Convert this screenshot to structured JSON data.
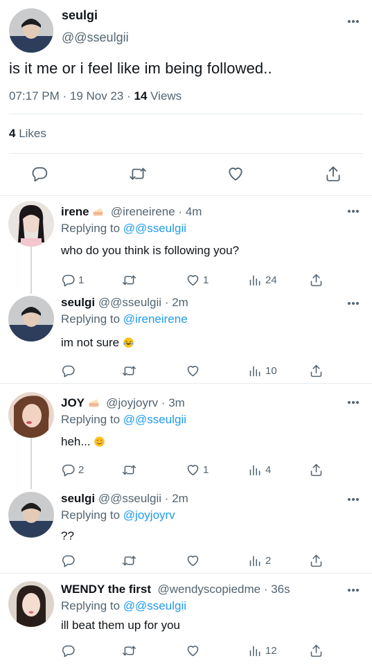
{
  "main_tweet": {
    "name": "seulgi",
    "handle": "@@sseulgii",
    "text": "is it me or i feel like im being followed..",
    "time": "07:17 PM",
    "date": "19 Nov 23",
    "views_count": "14",
    "views_label": "Views",
    "likes_count": "4",
    "likes_label": "Likes"
  },
  "replies": [
    {
      "name": "irene",
      "handle": "@ireneirene",
      "time": "4m",
      "replying_prefix": "Replying to",
      "replying_to": "@@sseulgii",
      "text": "who do you think is following you?",
      "reply_count": "1",
      "retweet_count": "",
      "like_count": "1",
      "views": "24"
    },
    {
      "name": "seulgi",
      "handle": "@@sseulgii",
      "time": "2m",
      "replying_prefix": "Replying to",
      "replying_to": "@ireneirene",
      "text": "im not sure",
      "reply_count": "",
      "retweet_count": "",
      "like_count": "",
      "views": "10"
    },
    {
      "name": "JOY",
      "handle": "@joyjoyrv",
      "time": "3m",
      "replying_prefix": "Replying to",
      "replying_to": "@@sseulgii",
      "text": "heh...",
      "reply_count": "2",
      "retweet_count": "",
      "like_count": "1",
      "views": "4"
    },
    {
      "name": "seulgi",
      "handle": "@@sseulgii",
      "time": "2m",
      "replying_prefix": "Replying to",
      "replying_to": "@joyjoyrv",
      "text": "??",
      "reply_count": "",
      "retweet_count": "",
      "like_count": "",
      "views": "2"
    },
    {
      "name": "WENDY the first",
      "handle": "@wendyscopiedme",
      "time": "36s",
      "replying_prefix": "Replying to",
      "replying_to": "@@sseulgii",
      "text": "ill beat them up for you",
      "reply_count": "",
      "retweet_count": "",
      "like_count": "",
      "views": "12"
    }
  ],
  "colors": {
    "accent": "#1d9bf0",
    "secondary_text": "#536471",
    "divider": "#e6ecf0"
  }
}
